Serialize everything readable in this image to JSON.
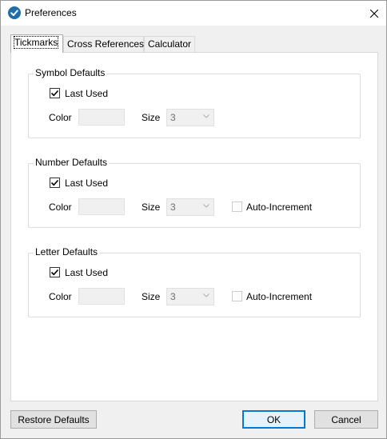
{
  "window": {
    "title": "Preferences"
  },
  "tabs": [
    {
      "label": "Tickmarks"
    },
    {
      "label": "Cross References"
    },
    {
      "label": "Calculator"
    }
  ],
  "groups": [
    {
      "title": "Symbol Defaults",
      "last_used_label": "Last Used",
      "last_used_checked": true,
      "color_label": "Color",
      "size_label": "Size",
      "size_value": "3"
    },
    {
      "title": "Number Defaults",
      "last_used_label": "Last Used",
      "last_used_checked": true,
      "color_label": "Color",
      "size_label": "Size",
      "size_value": "3",
      "auto_increment_label": "Auto-Increment",
      "auto_increment_checked": false
    },
    {
      "title": "Letter Defaults",
      "last_used_label": "Last Used",
      "last_used_checked": true,
      "color_label": "Color",
      "size_label": "Size",
      "size_value": "3",
      "auto_increment_label": "Auto-Increment",
      "auto_increment_checked": false
    }
  ],
  "buttons": {
    "restore_defaults": "Restore Defaults",
    "ok": "OK",
    "cancel": "Cancel"
  },
  "colors": {
    "accent": "#0078d7",
    "app_icon": "#1e6fa8"
  }
}
